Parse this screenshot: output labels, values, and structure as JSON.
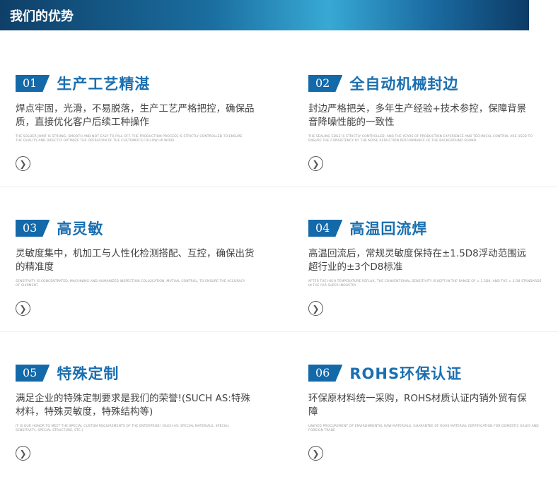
{
  "banner": {
    "title": "我们的优势"
  },
  "items": [
    {
      "num": "01",
      "title": "生产工艺精湛",
      "desc": "焊点牢固，光滑，不易脱落，生产工艺严格把控，确保品质，直接优化客户后续工种操作",
      "en": "The solder joint is strong, smooth and not easy to fall off. The production process is strictly controlled to ensure the quality and directly optimize the operation of the customer's follow up work."
    },
    {
      "num": "02",
      "title": "全自动机械封边",
      "desc": "封边严格把关，多年生产经验+技术参控，保障背景音降噪性能的一致性",
      "en": "The sealing edge is strictly controlled, and the years of production experience and technical control are used to ensure the consistency of the noise reduction performance of the background sound."
    },
    {
      "num": "03",
      "title": "高灵敏",
      "desc": "灵敏度集中，机加工与人性化检测搭配、互控，确保出货的精准度",
      "en": "Sensitivity is concentrated, machining and humanized inspection collocation, mutual control, to ensure the accuracy of shipment"
    },
    {
      "num": "04",
      "title": "高温回流焊",
      "desc": "高温回流后，常规灵敏度保持在±1.5D8浮动范围远超行业的±3个D8标准",
      "en": "After the high temperature reflux, the conventional sensitivity is kept in the range of ± 1.5D8, and the ± 3 D8 standards in the far super industry"
    },
    {
      "num": "05",
      "title": "特殊定制",
      "desc": "满足企业的特殊定制要求是我们的荣誉!(SUCH AS:特殊材料，特殊灵敏度，特殊结构等)",
      "en": "It is our honor to meet the special custom requirements of the enterprise! (such as: special materials, special sensitivity, special structure, etc.)"
    },
    {
      "num": "06",
      "title": "ROHS环保认证",
      "desc": "环保原材料统一采购，ROHS材质认证内销外贸有保障",
      "en": "Unified procurement of environmental raw materials, guarantee of ROHS material certification for domestic sales and foreign trade"
    }
  ],
  "colors": {
    "accent": "#1469a9",
    "title": "#1a6fb0",
    "banner_start": "#0f3f68",
    "banner_mid": "#38a9d4"
  },
  "icons": {
    "arrow": "chevron-right-circle-icon"
  }
}
